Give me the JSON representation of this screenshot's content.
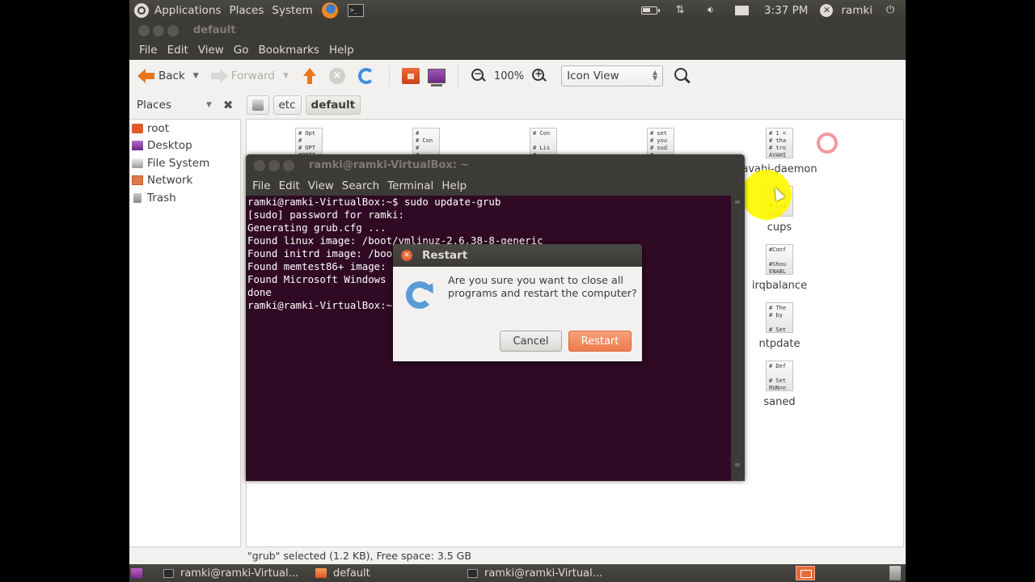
{
  "top_panel": {
    "menus": [
      "Applications",
      "Places",
      "System"
    ],
    "clock": "3:37 PM",
    "user": "ramki",
    "icons": [
      "ubuntu-logo-icon",
      "firefox-icon",
      "terminal-icon",
      "battery-icon",
      "network-icon",
      "volume-icon",
      "mail-icon",
      "user-icon",
      "power-icon"
    ]
  },
  "nautilus": {
    "window_title": "default",
    "menu": [
      "File",
      "Edit",
      "View",
      "Go",
      "Bookmarks",
      "Help"
    ],
    "toolbar": {
      "back": "Back",
      "forward": "Forward",
      "zoom_level": "100%",
      "view_mode": "Icon View"
    },
    "location": {
      "sidebar_title": "Places",
      "breadcrumbs": [
        "etc",
        "default"
      ]
    },
    "sidebar": [
      {
        "label": "root",
        "icon": "home-folder-icon"
      },
      {
        "label": "Desktop",
        "icon": "desktop-icon"
      },
      {
        "label": "File System",
        "icon": "drive-icon"
      },
      {
        "label": "Network",
        "icon": "network-folder-icon"
      },
      {
        "label": "Trash",
        "icon": "trash-icon"
      }
    ],
    "files": [
      {
        "name": "",
        "preview": "# Opt\n#\n# OPT\n#OPTI"
      },
      {
        "name": "",
        "preview": "#\n# Con\n#\n#"
      },
      {
        "name": "",
        "preview": "# Con\n\n# Lis\n#"
      },
      {
        "name": "",
        "preview": "# set\n# you\n# sud\n#"
      },
      {
        "name": "avahi-daemon",
        "preview": "# 1 =\n# tha\n# tro\nAVAHI"
      },
      {
        "name": "cups",
        "preview": "# Cup\n\n# LOA\nLOAD"
      },
      {
        "name": "irqbalance",
        "preview": "#Conf\n\n#Shou\nENABL"
      },
      {
        "name": "ntpdate",
        "preview": "# The\n# by\n\n# Set"
      },
      {
        "name": "saned",
        "preview": "# Def\n\n# Set\nRUN=n"
      }
    ],
    "status": "\"grub\" selected (1.2 KB), Free space: 3.5 GB"
  },
  "terminal": {
    "title": "ramki@ramki-VirtualBox: ~",
    "menu": [
      "File",
      "Edit",
      "View",
      "Search",
      "Terminal",
      "Help"
    ],
    "lines": [
      "ramki@ramki-VirtualBox:~$ sudo update-grub",
      "[sudo] password for ramki:",
      "Generating grub.cfg ...",
      "Found linux image: /boot/vmlinuz-2.6.38-8-generic",
      "Found initrd image: /boot/initrd.img-2.6.38-8-generic",
      "Found memtest86+ image: /boot/memtest86+.bin",
      "Found Microsoft Windows",
      "done",
      "ramki@ramki-VirtualBox:~$ "
    ]
  },
  "dialog": {
    "title": "Restart",
    "message": "Are you sure you want to close all programs and restart the computer?",
    "cancel": "Cancel",
    "confirm": "Restart"
  },
  "bottom_panel": {
    "tasks": [
      {
        "label": "ramki@ramki-Virtual...",
        "icon": "terminal-icon"
      },
      {
        "label": "default",
        "icon": "folder-icon"
      },
      {
        "label": "ramki@ramki-Virtual...",
        "icon": "terminal-icon"
      }
    ]
  }
}
